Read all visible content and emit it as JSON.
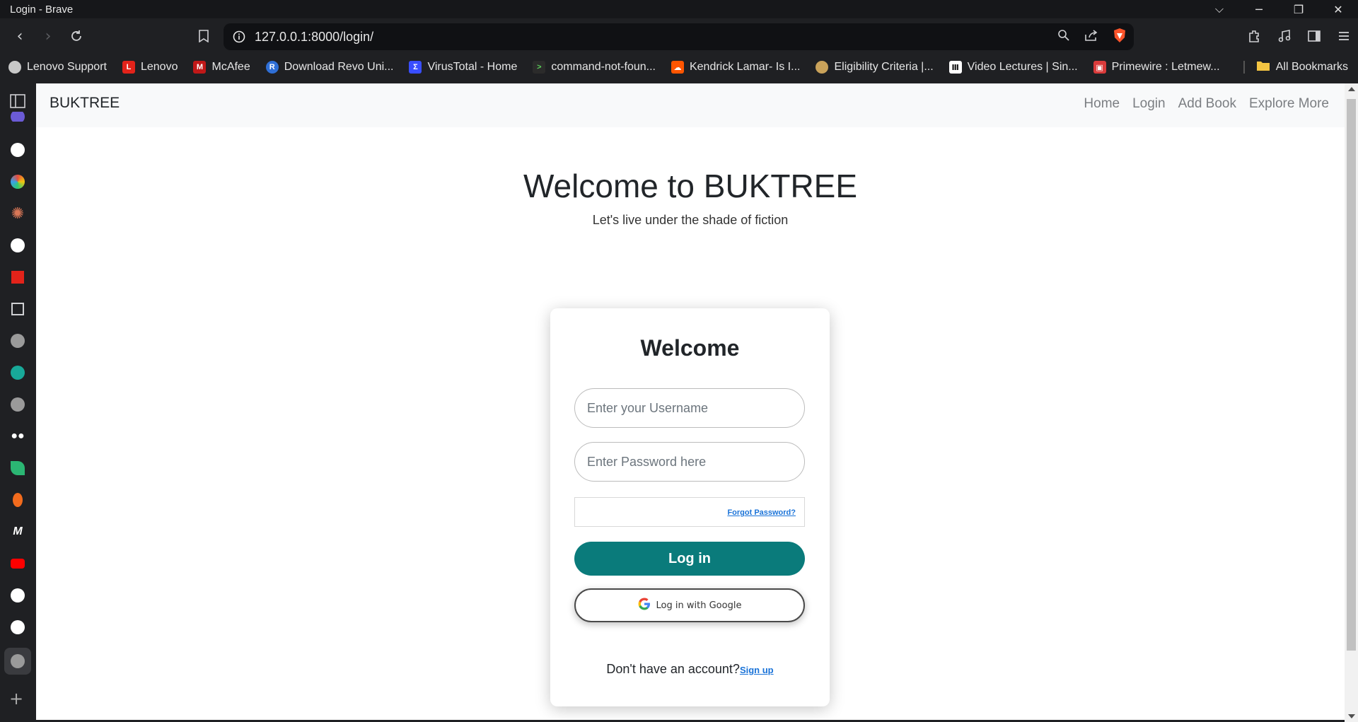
{
  "window": {
    "title": "Login - Brave"
  },
  "toolbar": {
    "url": "127.0.0.1:8000/login/"
  },
  "bookmarks": {
    "items": [
      {
        "label": "Lenovo Support",
        "color": "#c8c8c8",
        "icon": "globe-icon"
      },
      {
        "label": "Lenovo",
        "color": "#e2231a",
        "icon": "lenovo-icon"
      },
      {
        "label": "McAfee",
        "color": "#c01818",
        "icon": "mcafee-icon"
      },
      {
        "label": "Download Revo Uni...",
        "color": "#2f6fd6",
        "icon": "revo-icon"
      },
      {
        "label": "VirusTotal - Home",
        "color": "#394eff",
        "icon": "virustotal-icon"
      },
      {
        "label": "command-not-foun...",
        "color": "#2b2b2b",
        "icon": "terminal-icon"
      },
      {
        "label": "Kendrick Lamar- Is I...",
        "color": "#ff5500",
        "icon": "soundcloud-icon"
      },
      {
        "label": "Eligibility Criteria |...",
        "color": "#c9a25a",
        "icon": "eligibility-icon"
      },
      {
        "label": "Video Lectures | Sin...",
        "color": "#ffffff",
        "icon": "lectures-icon"
      },
      {
        "label": "Primewire : Letmew...",
        "color": "#d93b3b",
        "icon": "primewire-icon"
      }
    ],
    "all_label": "All Bookmarks"
  },
  "sidebar": {
    "items": [
      {
        "name": "sidebar-panel-icon",
        "color": "#cfd0d3"
      },
      {
        "name": "devtools-icon",
        "color": "#6b5bd6"
      },
      {
        "name": "github-icon",
        "color": "#ffffff"
      },
      {
        "name": "colorful-app-icon",
        "color": "#3aa0e8"
      },
      {
        "name": "claude-icon",
        "color": "#d97757"
      },
      {
        "name": "github-icon",
        "color": "#ffffff"
      },
      {
        "name": "red-app-icon",
        "color": "#e2231a"
      },
      {
        "name": "reader-icon",
        "color": "#cfd0d3"
      },
      {
        "name": "globe-icon",
        "color": "#9a9a9a"
      },
      {
        "name": "feather-icon",
        "color": "#18a999"
      },
      {
        "name": "globe-icon",
        "color": "#9a9a9a"
      },
      {
        "name": "medium-icon",
        "color": "#ffffff"
      },
      {
        "name": "leaf-icon",
        "color": "#2bb673"
      },
      {
        "name": "fire-icon",
        "color": "#f26b1d"
      },
      {
        "name": "m-icon",
        "color": "#ffffff"
      },
      {
        "name": "youtube-icon",
        "color": "#ff0000"
      },
      {
        "name": "github-icon",
        "color": "#ffffff"
      },
      {
        "name": "github-icon",
        "color": "#ffffff"
      },
      {
        "name": "globe-icon",
        "color": "#9a9a9a"
      }
    ]
  },
  "page": {
    "brand": "BUKTREE",
    "nav": [
      "Home",
      "Login",
      "Add Book",
      "Explore More"
    ],
    "hero_title": "Welcome to BUKTREE",
    "hero_subtitle": "Let's live under the shade of fiction",
    "card": {
      "title": "Welcome",
      "username_placeholder": "Enter your Username",
      "password_placeholder": "Enter Password here",
      "forgot_label": "Forgot Password?",
      "login_label": "Log in",
      "google_label": "Log in with Google",
      "no_account_text": "Don't have an account?",
      "signup_label": "Sign up"
    },
    "accent_color": "#0a7b7b"
  }
}
